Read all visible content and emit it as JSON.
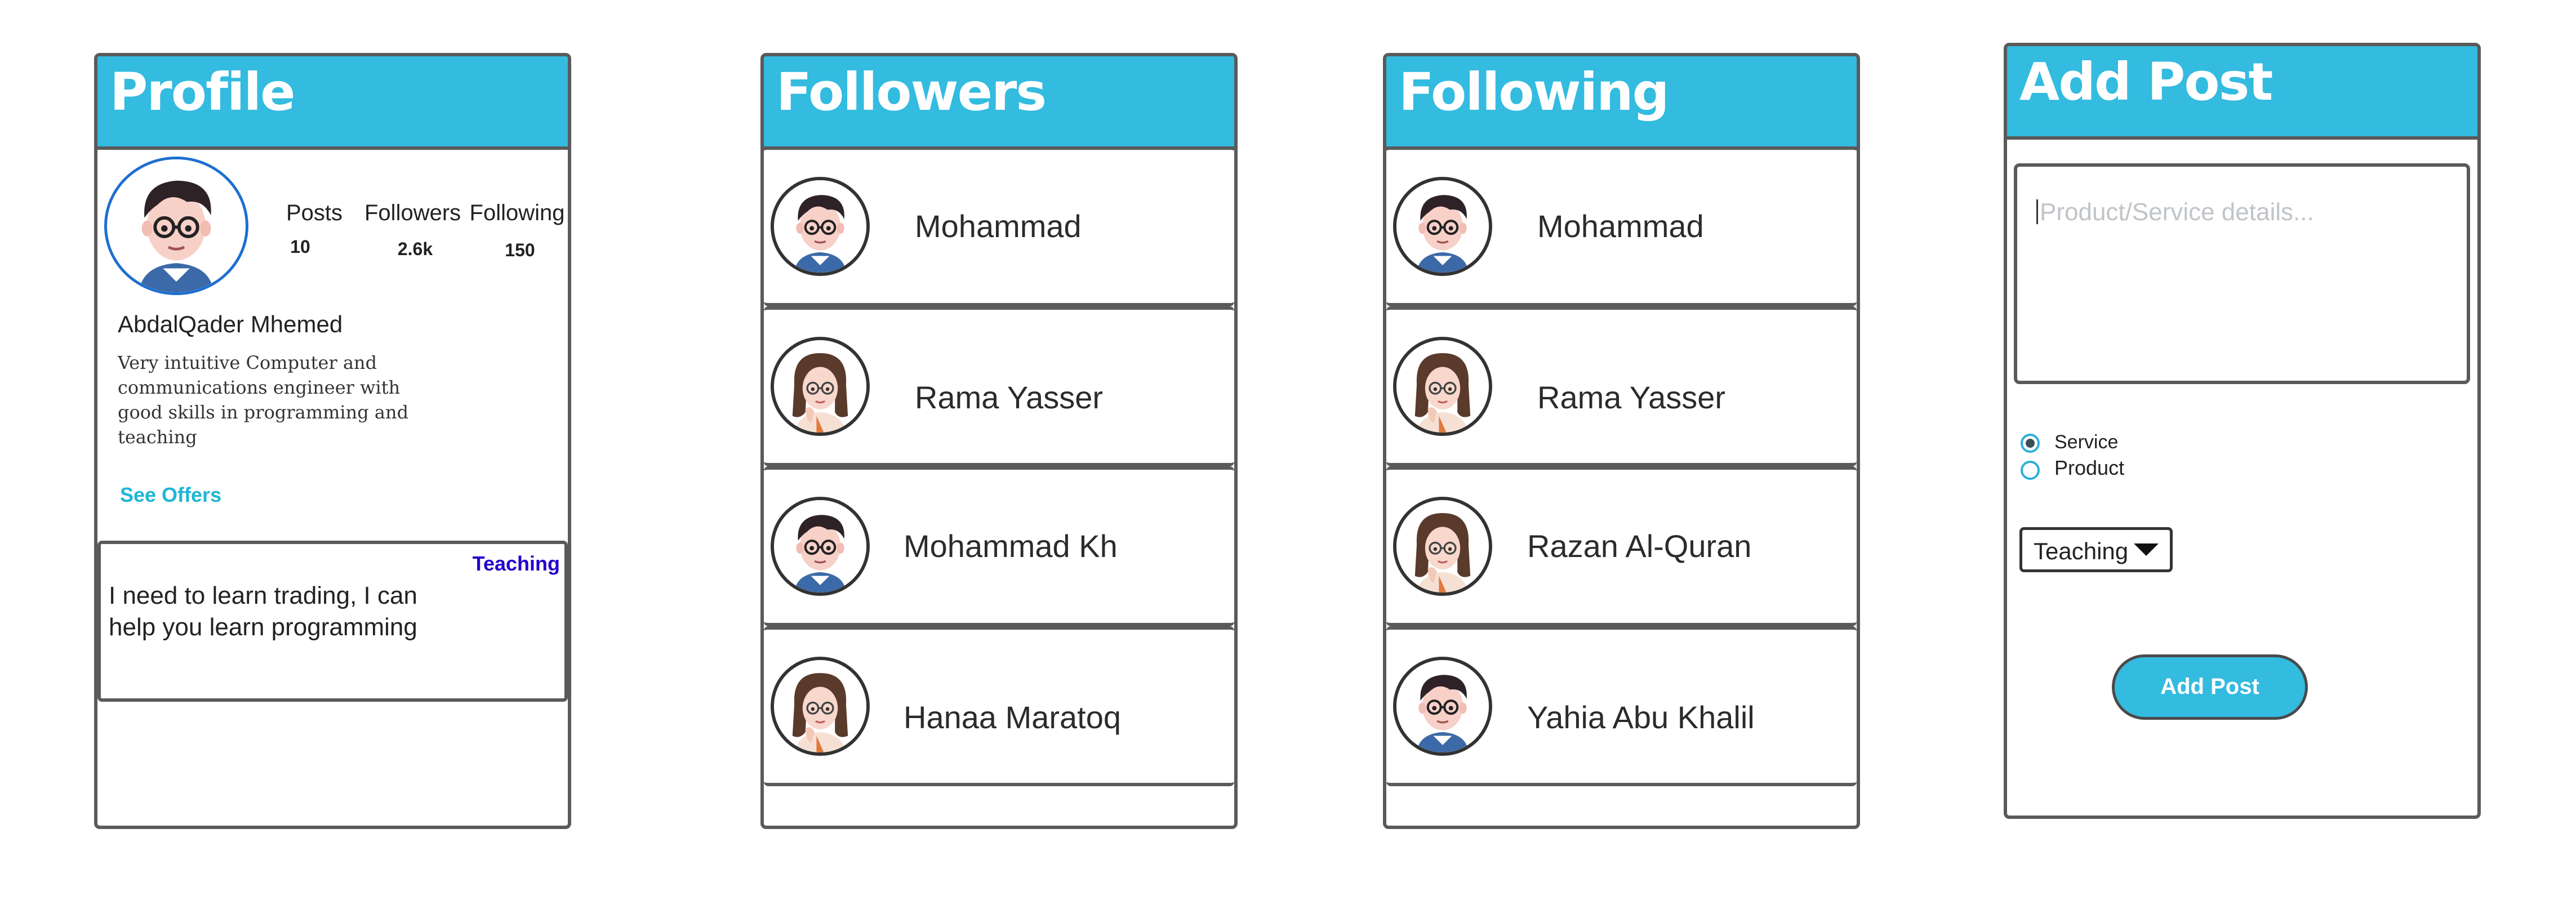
{
  "colors": {
    "header": "#33bbe0",
    "border": "#5a5a5a",
    "link": "#1fb5d6",
    "category_tag": "#2200cc",
    "button": "#33bbe0"
  },
  "profile": {
    "title": "Profile",
    "stats": [
      {
        "label": "Posts",
        "value": "10"
      },
      {
        "label": "Followers",
        "value": "2.6k"
      },
      {
        "label": "Following",
        "value": "150"
      }
    ],
    "name": "AbdalQader Mhemed",
    "bio": "Very intuitive Computer and communications engineer with good skills in programming and teaching",
    "see_offers": "See Offers",
    "post": {
      "category": "Teaching",
      "text": "I need to learn trading, I can help you learn programming"
    }
  },
  "followers": {
    "title": "Followers",
    "items": [
      {
        "name": "Mohammad",
        "avatar": "male-avatar-icon"
      },
      {
        "name": "Rama Yasser",
        "avatar": "female-avatar-icon"
      },
      {
        "name": "Mohammad Kh",
        "avatar": "male-avatar-icon"
      },
      {
        "name": "Hanaa Maratoq",
        "avatar": "female-avatar-icon"
      }
    ]
  },
  "following": {
    "title": "Following",
    "items": [
      {
        "name": "Mohammad",
        "avatar": "male-avatar-icon"
      },
      {
        "name": "Rama Yasser",
        "avatar": "female-avatar-icon"
      },
      {
        "name": "Razan Al-Quran",
        "avatar": "female-avatar-icon"
      },
      {
        "name": "Yahia Abu Khalil",
        "avatar": "male-avatar-icon"
      }
    ]
  },
  "add_post": {
    "title": "Add Post",
    "details_placeholder": "Product/Service details...",
    "options": [
      {
        "label": "Service",
        "checked": true
      },
      {
        "label": "Product",
        "checked": false
      }
    ],
    "category_selected": "Teaching",
    "submit_label": "Add Post"
  }
}
